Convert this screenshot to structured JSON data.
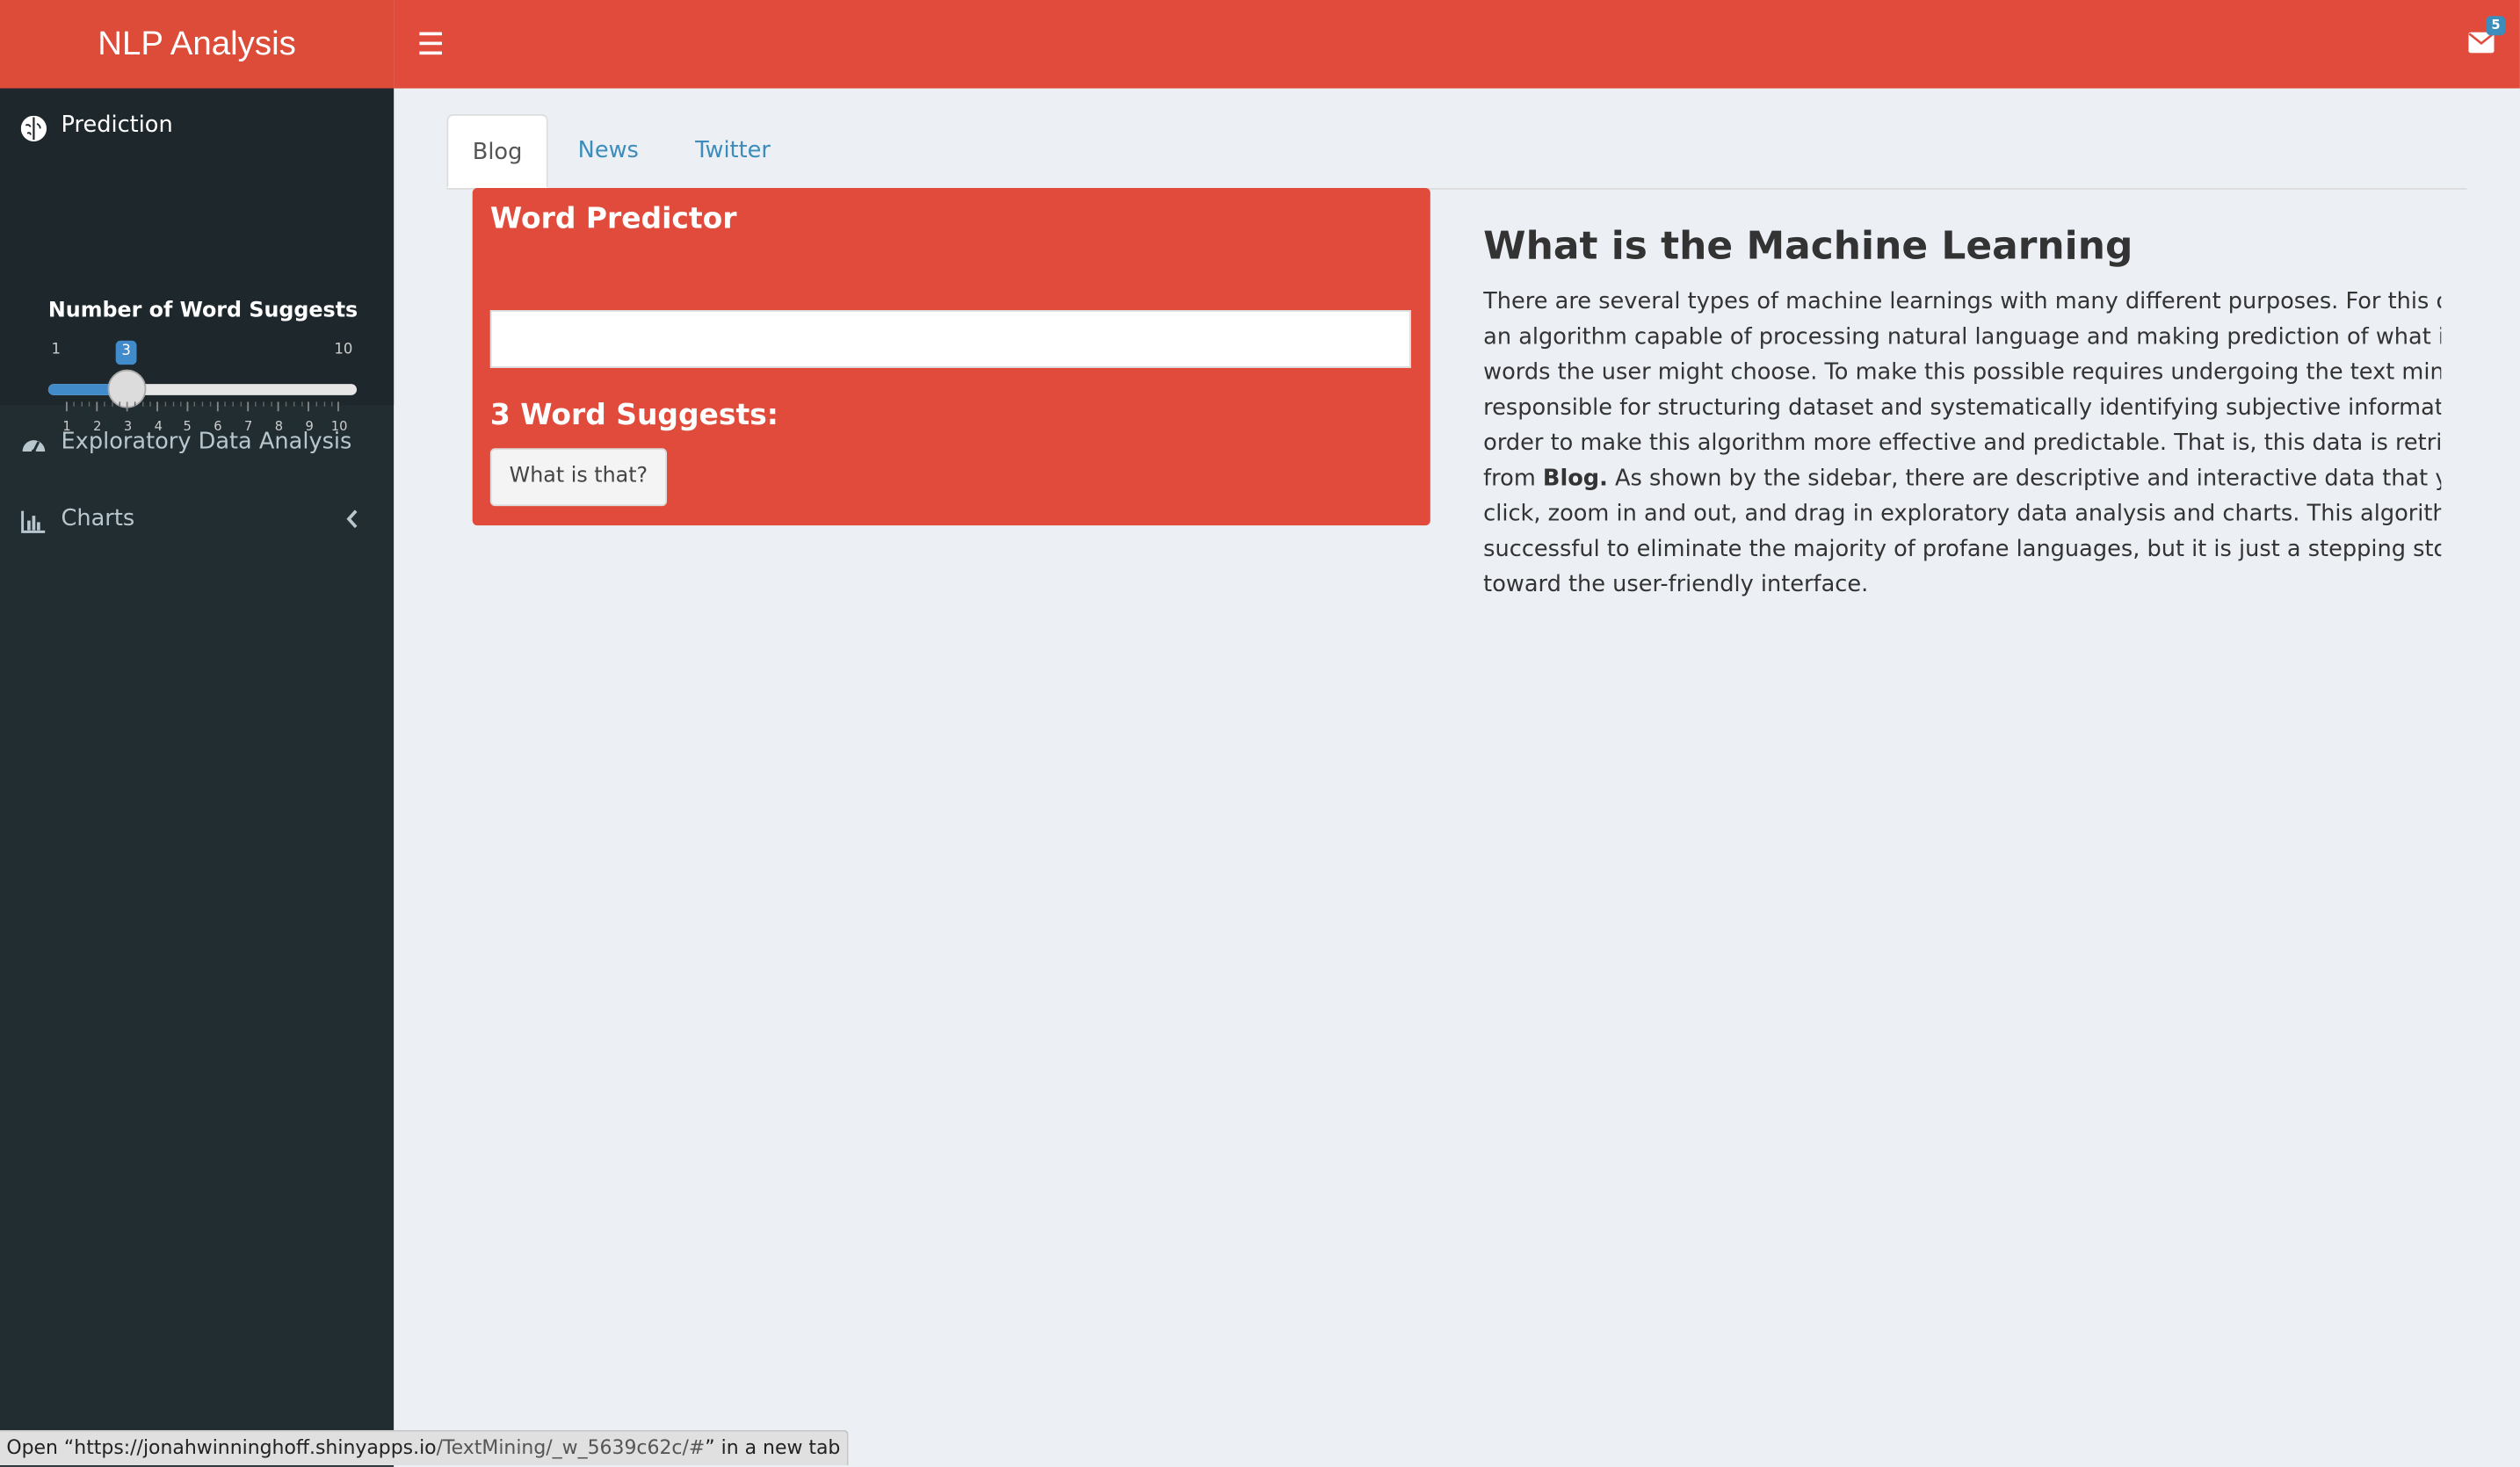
{
  "app": {
    "title": "NLP Analysis",
    "notification_count": "5"
  },
  "sidebar": {
    "items": [
      {
        "label": "Prediction",
        "icon": "brain-icon",
        "active": true
      },
      {
        "label": "Exploratory Data Analysis",
        "icon": "dashboard-icon",
        "active": false
      },
      {
        "label": "Charts",
        "icon": "bar-chart-icon",
        "active": false
      }
    ],
    "slider": {
      "label": "Number of Word Suggests",
      "min": "1",
      "max": "10",
      "value": "3",
      "tick_labels": [
        "1",
        "2",
        "3",
        "4",
        "5",
        "6",
        "7",
        "8",
        "9",
        "10"
      ]
    }
  },
  "tabs": [
    "Blog",
    "News",
    "Twitter"
  ],
  "predictor": {
    "title": "Word Predictor",
    "input_value": "",
    "suggest_title": "3 Word Suggests:",
    "suggestion": "What is that?"
  },
  "article": {
    "title": "What is the Machine Learning",
    "lines": [
      "There are several types of machine learnings with many different purposes. For this one, it is",
      "an algorithm capable of processing natural language and making prediction of what is next",
      "words the user might choose. To make this possible requires undergoing the text mining",
      "responsible for structuring dataset and systematically identifying subjective information in",
      "order to make this algorithm more effective and predictable. That is, this data is retrieved",
      "As shown by the sidebar, there are descriptive and interactive data that you can",
      "click, zoom in and out, and drag in exploratory data analysis and charts. This algorithm is",
      "successful to eliminate the majority of profane languages, but it is just a stepping stone",
      "toward the user-friendly interface."
    ],
    "line6_prefix": "from",
    "line6_bold": "Blog."
  },
  "statusbar": {
    "prefix": "Open “https://jonahwinninghoff.shinyapps.io",
    "path": "/TextMining/_w_5639c62c/#",
    "suffix": "” in a new tab"
  },
  "colors": {
    "header": "#dd4b39",
    "sidebar": "#222d32",
    "accent": "#3c8dbc",
    "background": "#ecf0f5"
  }
}
